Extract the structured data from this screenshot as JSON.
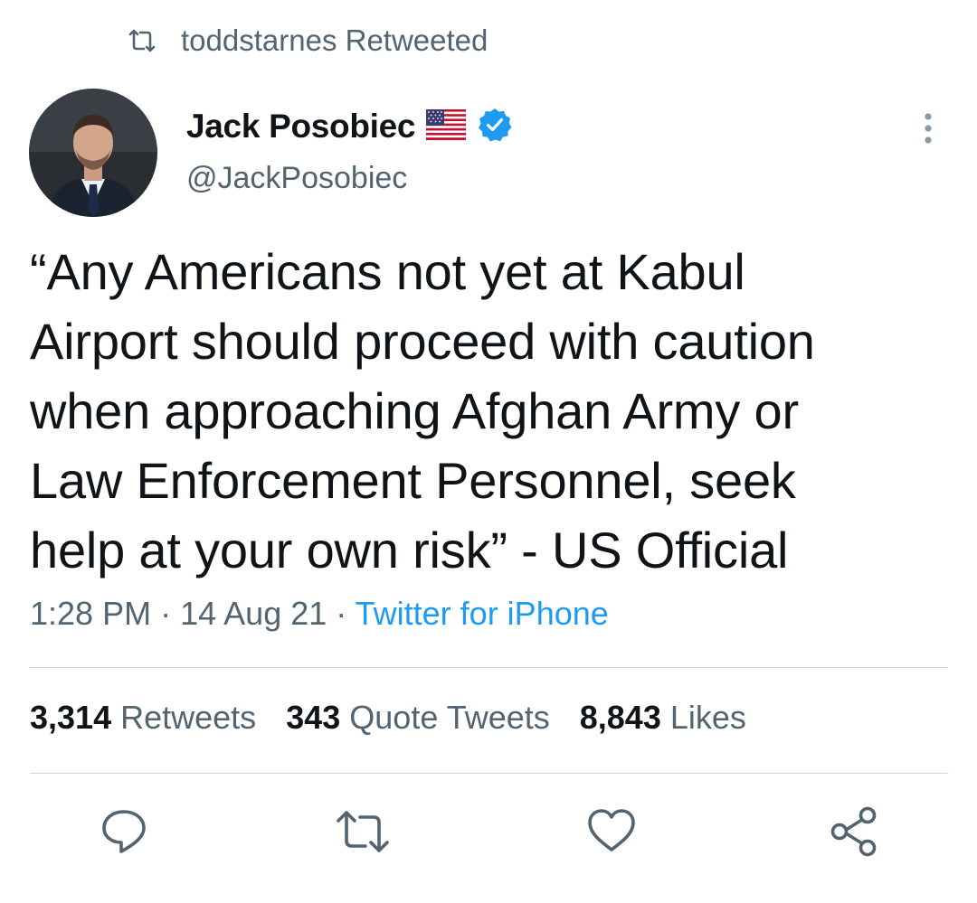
{
  "retweet_header": {
    "icon": "retweet-icon",
    "text": "toddstarnes Retweeted"
  },
  "author": {
    "display_name": "Jack Posobiec",
    "handle": "@JackPosobiec",
    "flag_icon": "us-flag-icon",
    "verified_icon": "verified-badge-icon",
    "verified_color": "#1d9bf0"
  },
  "tweet": {
    "lines": [
      "“Any Americans not yet at Kabul",
      "Airport should proceed with caution",
      "when approaching Afghan Army or",
      "Law Enforcement Personnel, seek",
      "help at your own risk” - US Official"
    ],
    "time": "1:28 PM",
    "separator": "·",
    "date": "14 Aug 21",
    "source": "Twitter for iPhone"
  },
  "stats": {
    "retweets_count": "3,314",
    "retweets_label": "Retweets",
    "quotes_count": "343",
    "quotes_label": "Quote Tweets",
    "likes_count": "8,843",
    "likes_label": "Likes"
  },
  "actions": [
    "reply-icon",
    "retweet-icon",
    "like-icon",
    "share-icon"
  ],
  "colors": {
    "text_primary": "#0f1419",
    "text_secondary": "#536471",
    "accent": "#1d9bf0",
    "divider": "#cfd9de"
  }
}
